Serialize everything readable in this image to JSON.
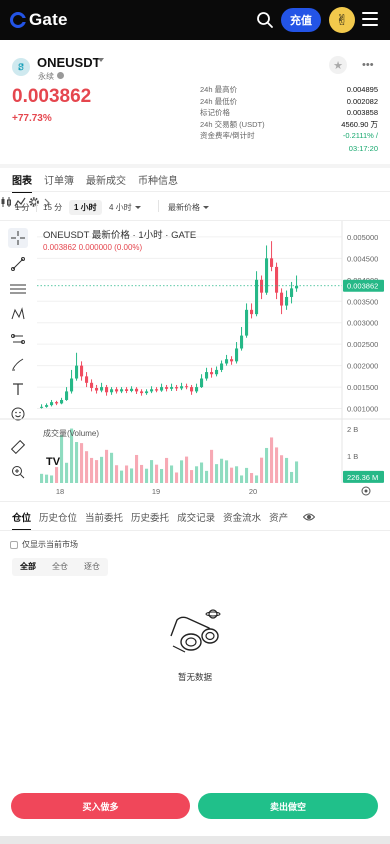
{
  "header": {
    "brand": "Gate",
    "deposit_label": "充值"
  },
  "market": {
    "pair": "ONEUSDT",
    "contract_type": "永续",
    "last_price": "0.003862",
    "change_pct": "+77.73%",
    "stats": [
      {
        "label": "24h 最高价",
        "value": "0.004895"
      },
      {
        "label": "24h 最低价",
        "value": "0.002082"
      },
      {
        "label": "标记价格",
        "value": "0.003858"
      },
      {
        "label": "24h 交易额 (USDT)",
        "value": "4560.90 万"
      },
      {
        "label": "资金费率/倒计时",
        "value": "-0.2111% /"
      }
    ],
    "funding_countdown": "03:17:20",
    "price_color": "#e5464e",
    "up_color": "#17a86e"
  },
  "chart_tabs": [
    {
      "label": "图表",
      "active": true
    },
    {
      "label": "订单簿",
      "active": false
    },
    {
      "label": "最新成交",
      "active": false
    },
    {
      "label": "币种信息",
      "active": false
    }
  ],
  "intervals": {
    "one_min": "1 分",
    "fifteen_min": "15 分",
    "one_hour": "1 小时",
    "four_hour": "4 小时",
    "price_type": "最新价格"
  },
  "chart_overlay": {
    "title": "ONEUSDT 最新价格 · 1小时 · GATE",
    "ohlc": "0.003862  0.000000 (0.00%)",
    "volume_label": "成交量(Volume)",
    "tv_logo": "TV"
  },
  "chart_data": {
    "type": "candlestick",
    "interval": "1小时",
    "x_tick_labels": [
      "18",
      "19",
      "20"
    ],
    "y_tick_labels": [
      "0.005000",
      "0.004500",
      "0.004000",
      "0.003500",
      "0.003000",
      "0.002500",
      "0.002000",
      "0.001500",
      "0.001000"
    ],
    "ylim": [
      0.00085,
      0.00523
    ],
    "last_price_marker": "0.003862",
    "volume_tick_labels": [
      "2 B",
      "1 B"
    ],
    "volume_marker": "226.36 M",
    "up_color": "#26b887",
    "down_color": "#f04c60",
    "candles": [
      [
        0.00102,
        0.00104,
        0.0011,
        0.001
      ],
      [
        0.00104,
        0.00108,
        0.00112,
        0.00102
      ],
      [
        0.00108,
        0.00115,
        0.0012,
        0.00105
      ],
      [
        0.00115,
        0.00112,
        0.00118,
        0.00108
      ],
      [
        0.00112,
        0.0012,
        0.00125,
        0.0011
      ],
      [
        0.0012,
        0.0014,
        0.0015,
        0.00118
      ],
      [
        0.0014,
        0.0017,
        0.0019,
        0.00135
      ],
      [
        0.0017,
        0.002,
        0.0023,
        0.00165
      ],
      [
        0.002,
        0.00175,
        0.0021,
        0.00165
      ],
      [
        0.00175,
        0.0016,
        0.00185,
        0.0015
      ],
      [
        0.0016,
        0.00148,
        0.00168,
        0.0014
      ],
      [
        0.00148,
        0.00142,
        0.00155,
        0.00135
      ],
      [
        0.00142,
        0.0015,
        0.0016,
        0.00138
      ],
      [
        0.0015,
        0.00138,
        0.00155,
        0.0013
      ],
      [
        0.00138,
        0.00145,
        0.0015,
        0.00132
      ],
      [
        0.00145,
        0.0014,
        0.0015,
        0.00135
      ],
      [
        0.0014,
        0.00145,
        0.0015,
        0.00136
      ],
      [
        0.00145,
        0.00141,
        0.0015,
        0.00136
      ],
      [
        0.00141,
        0.00146,
        0.00152,
        0.00138
      ],
      [
        0.00146,
        0.0014,
        0.0015,
        0.00134
      ],
      [
        0.0014,
        0.00136,
        0.00145,
        0.0013
      ],
      [
        0.00136,
        0.0014,
        0.00145,
        0.00132
      ],
      [
        0.0014,
        0.00145,
        0.00152,
        0.00136
      ],
      [
        0.00145,
        0.00142,
        0.0015,
        0.00138
      ],
      [
        0.00142,
        0.0015,
        0.00158,
        0.00139
      ],
      [
        0.0015,
        0.00146,
        0.00155,
        0.0014
      ],
      [
        0.00146,
        0.0015,
        0.00158,
        0.00141
      ],
      [
        0.0015,
        0.00147,
        0.00155,
        0.00141
      ],
      [
        0.00147,
        0.00152,
        0.0016,
        0.00143
      ],
      [
        0.00152,
        0.0015,
        0.00158,
        0.00145
      ],
      [
        0.0015,
        0.0014,
        0.00155,
        0.00132
      ],
      [
        0.0014,
        0.0015,
        0.00158,
        0.00136
      ],
      [
        0.0015,
        0.0017,
        0.0018,
        0.00148
      ],
      [
        0.0017,
        0.00185,
        0.00195,
        0.00165
      ],
      [
        0.00185,
        0.0018,
        0.00195,
        0.00172
      ],
      [
        0.0018,
        0.0019,
        0.00198,
        0.00175
      ],
      [
        0.0019,
        0.00205,
        0.00212,
        0.00185
      ],
      [
        0.00205,
        0.00215,
        0.00225,
        0.002
      ],
      [
        0.00215,
        0.0021,
        0.00222,
        0.00202
      ],
      [
        0.0021,
        0.0024,
        0.00255,
        0.00205
      ],
      [
        0.0024,
        0.0027,
        0.0029,
        0.00235
      ],
      [
        0.0027,
        0.0033,
        0.00345,
        0.00265
      ],
      [
        0.0033,
        0.0032,
        0.00345,
        0.0031
      ],
      [
        0.0032,
        0.004,
        0.0042,
        0.00315
      ],
      [
        0.004,
        0.0037,
        0.0041,
        0.00355
      ],
      [
        0.0037,
        0.0045,
        0.0048,
        0.00365
      ],
      [
        0.0045,
        0.0043,
        0.0049,
        0.0042
      ],
      [
        0.0043,
        0.0037,
        0.0044,
        0.00355
      ],
      [
        0.0037,
        0.0034,
        0.0038,
        0.0032
      ],
      [
        0.0034,
        0.0036,
        0.00375,
        0.0033
      ],
      [
        0.0036,
        0.0038,
        0.00395,
        0.00345
      ],
      [
        0.0038,
        0.00386,
        0.0041,
        0.00372
      ]
    ],
    "volumes": [
      0.34,
      0.31,
      0.28,
      0.59,
      1.78,
      0.75,
      2.02,
      1.52,
      1.48,
      1.18,
      0.93,
      0.85,
      0.97,
      1.23,
      1.12,
      0.66,
      0.46,
      0.65,
      0.54,
      1.04,
      0.67,
      0.53,
      0.85,
      0.68,
      0.52,
      0.93,
      0.65,
      0.39,
      0.84,
      0.98,
      0.48,
      0.62,
      0.76,
      0.45,
      1.23,
      0.7,
      0.9,
      0.84,
      0.57,
      0.62,
      0.28,
      0.56,
      0.37,
      0.28,
      0.94,
      1.3,
      1.69,
      1.32,
      1.03,
      0.93,
      0.41,
      0.8
    ]
  },
  "positions": {
    "tabs": [
      {
        "label": "仓位",
        "active": true
      },
      {
        "label": "历史仓位",
        "active": false
      },
      {
        "label": "当前委托",
        "active": false
      },
      {
        "label": "历史委托",
        "active": false
      },
      {
        "label": "成交记录",
        "active": false
      },
      {
        "label": "资金流水",
        "active": false
      },
      {
        "label": "资产",
        "active": false
      }
    ],
    "only_current_market": "仅显示当前市场",
    "filters": [
      {
        "label": "全部",
        "active": true
      },
      {
        "label": "全仓",
        "active": false
      },
      {
        "label": "逐仓",
        "active": false
      }
    ],
    "empty_text": "暂无数据"
  },
  "actions": {
    "buy_label": "买入做多",
    "sell_label": "卖出做空"
  }
}
